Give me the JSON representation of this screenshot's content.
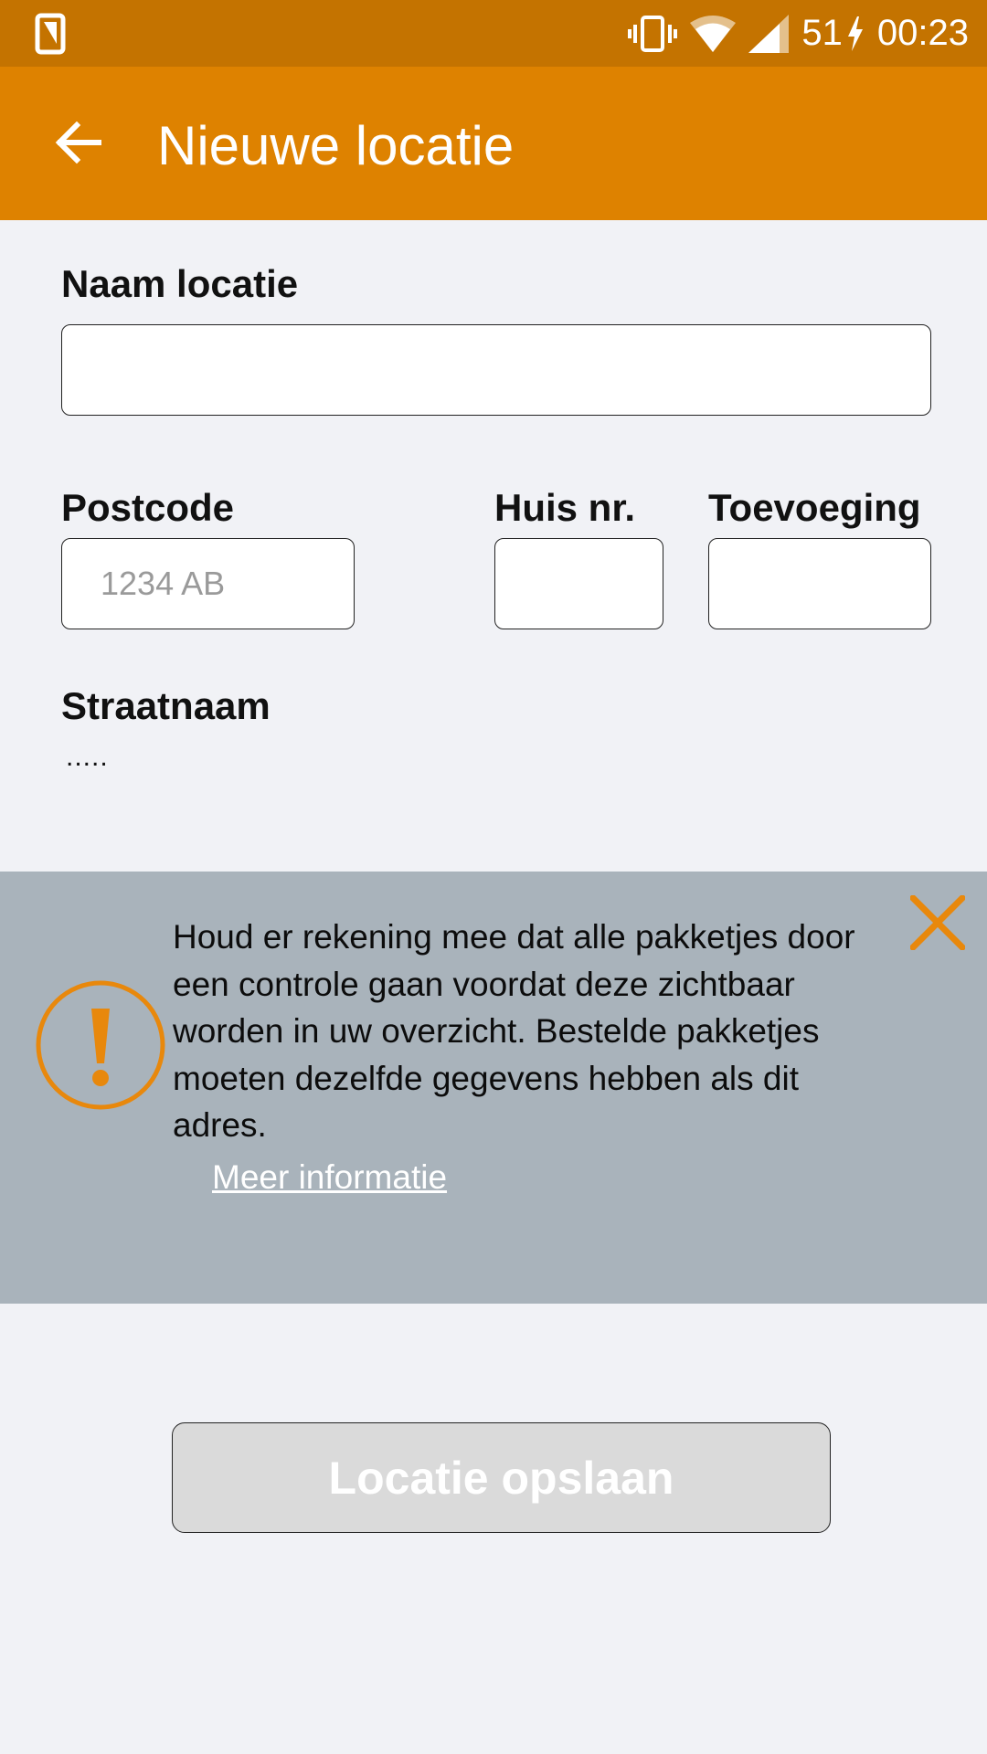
{
  "status_bar": {
    "battery": "51",
    "time": "00:23",
    "icons": [
      "notification-icon",
      "vibrate-icon",
      "wifi-icon",
      "cell-signal-icon",
      "charging-icon"
    ]
  },
  "app_bar": {
    "title": "Nieuwe locatie",
    "back_icon": "arrow-left-icon"
  },
  "form": {
    "name_label": "Naam locatie",
    "name_value": "",
    "postcode_label": "Postcode",
    "postcode_placeholder": "1234 AB",
    "house_number_label": "Huis nr.",
    "house_number_value": "",
    "addition_label": "Toevoeging",
    "addition_value": "",
    "street_label": "Straatnaam",
    "street_value": "....."
  },
  "notice": {
    "text": "Houd er rekening mee dat alle pakketjes door een controle gaan voordat deze zichtbaar worden in uw overzicht. Bestelde pakketjes moeten dezelfde gegevens hebben als dit adres.",
    "link": "Meer informatie",
    "icon": "warning-icon",
    "close_icon": "close-icon"
  },
  "actions": {
    "save_label": "Locatie opslaan"
  },
  "colors": {
    "status_bar": "#c47300",
    "app_bar": "#de8200",
    "accent": "#e8880c",
    "notice_background": "#a9b3bb",
    "page_background": "#f1f2f6",
    "disabled_button": "#dadada"
  }
}
